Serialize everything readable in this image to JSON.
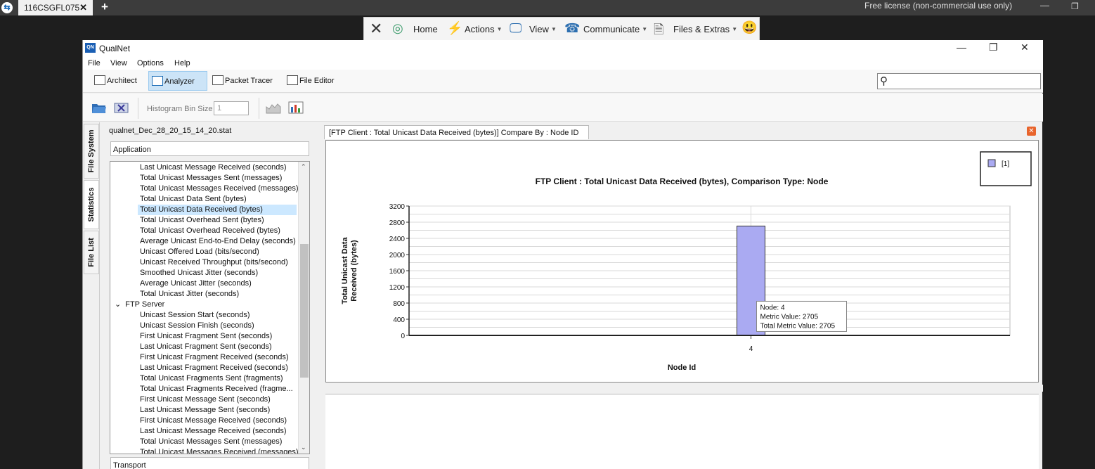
{
  "remote": {
    "tab_title": "116CSGFL075",
    "tab_close": "✕",
    "new_tab": "+",
    "license": "Free license (non-commercial use only)",
    "toolbar": {
      "close": "✕",
      "home": "Home",
      "actions": "Actions",
      "view": "View",
      "communicate": "Communicate",
      "files_extras": "Files & Extras",
      "emoji": "😃"
    },
    "grip": "⠿ ⤡ ⌃"
  },
  "app": {
    "title": "QualNet",
    "logo": "QN",
    "menu": [
      "File",
      "View",
      "Options",
      "Help"
    ],
    "perspectives": [
      "Architect",
      "Analyzer",
      "Packet Tracer",
      "File Editor"
    ],
    "search_placeholder": ""
  },
  "toolbar": {
    "histogram_label": "Histogram Bin Size",
    "histogram_value": "1"
  },
  "side_tabs": [
    "File System",
    "Statistics",
    "File List"
  ],
  "stats": {
    "file": "qualnet_Dec_28_20_15_14_20.stat",
    "section_app": "Application",
    "section_transport": "Transport",
    "tree": [
      {
        "label": "Last Unicast Message Received (seconds)",
        "indent": 2
      },
      {
        "label": "Total Unicast Messages Sent (messages)",
        "indent": 2
      },
      {
        "label": "Total Unicast Messages Received (messages)",
        "indent": 2
      },
      {
        "label": "Total Unicast Data Sent (bytes)",
        "indent": 2
      },
      {
        "label": "Total Unicast Data Received (bytes)",
        "indent": 2,
        "selected": true
      },
      {
        "label": "Total Unicast Overhead Sent (bytes)",
        "indent": 2
      },
      {
        "label": "Total Unicast Overhead Received (bytes)",
        "indent": 2
      },
      {
        "label": "Average Unicast End-to-End Delay (seconds)",
        "indent": 2
      },
      {
        "label": "Unicast Offered Load (bits/second)",
        "indent": 2
      },
      {
        "label": "Unicast Received Throughput (bits/second)",
        "indent": 2
      },
      {
        "label": "Smoothed Unicast Jitter (seconds)",
        "indent": 2
      },
      {
        "label": "Average Unicast Jitter (seconds)",
        "indent": 2
      },
      {
        "label": "Total Unicast Jitter (seconds)",
        "indent": 2
      },
      {
        "label": "FTP Server",
        "indent": 1,
        "expander": "⌄"
      },
      {
        "label": "Unicast Session Start (seconds)",
        "indent": 2
      },
      {
        "label": "Unicast Session Finish (seconds)",
        "indent": 2
      },
      {
        "label": "First Unicast Fragment Sent (seconds)",
        "indent": 2
      },
      {
        "label": "Last Unicast Fragment Sent (seconds)",
        "indent": 2
      },
      {
        "label": "First Unicast Fragment Received (seconds)",
        "indent": 2
      },
      {
        "label": "Last Unicast Fragment Received (seconds)",
        "indent": 2
      },
      {
        "label": "Total Unicast Fragments Sent (fragments)",
        "indent": 2
      },
      {
        "label": "Total Unicast Fragments Received (fragme...",
        "indent": 2
      },
      {
        "label": "First Unicast Message Sent (seconds)",
        "indent": 2
      },
      {
        "label": "Last Unicast Message Sent (seconds)",
        "indent": 2
      },
      {
        "label": "First Unicast Message Received (seconds)",
        "indent": 2
      },
      {
        "label": "Last Unicast Message Received (seconds)",
        "indent": 2
      },
      {
        "label": "Total Unicast Messages Sent (messages)",
        "indent": 2
      },
      {
        "label": "Total Unicast Messages Received (messages)",
        "indent": 2
      }
    ]
  },
  "chart_tab": "[FTP Client :  Total Unicast Data Received (bytes)] Compare By : Node ID",
  "chart_close": "✕",
  "chart_data": {
    "type": "bar",
    "title": "FTP Client :  Total Unicast Data Received (bytes), Comparison Type: Node",
    "xlabel": "Node Id",
    "ylabel_lines": [
      "Total Unicast Data",
      "Received (bytes)"
    ],
    "categories": [
      "4"
    ],
    "series": [
      {
        "name": "[1]",
        "values": [
          2705
        ],
        "color": "#aaaaf2"
      }
    ],
    "ylim": [
      0,
      3200
    ],
    "yticks": [
      0,
      400,
      800,
      1200,
      1600,
      2000,
      2400,
      2800,
      3200
    ],
    "grid": true,
    "legend": "top-right",
    "tooltip": [
      "Node: 4",
      "Metric Value: 2705",
      "Total Metric Value: 2705"
    ]
  }
}
